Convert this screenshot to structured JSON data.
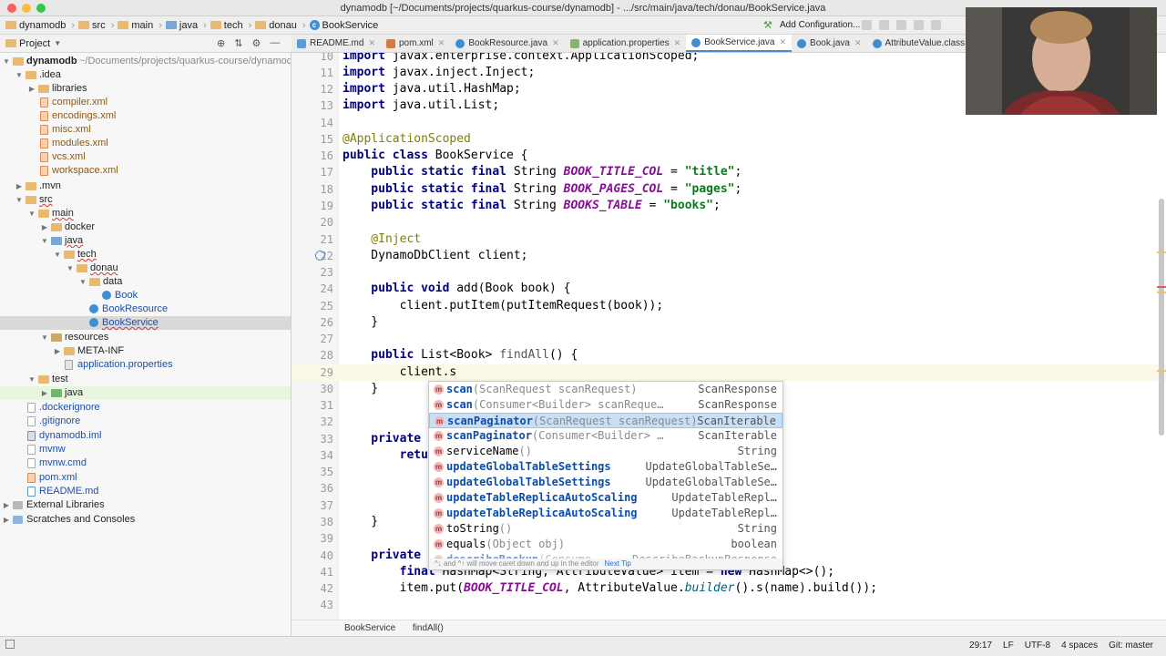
{
  "window": {
    "title": "dynamodb [~/Documents/projects/quarkus-course/dynamodb] - .../src/main/java/tech/donau/BookService.java"
  },
  "navbar": {
    "crumbs": [
      "dynamodb",
      "src",
      "main",
      "java",
      "tech",
      "donau",
      "BookService"
    ],
    "add_configuration": "Add Configuration..."
  },
  "project_panel": {
    "title": "Project",
    "tree": [
      {
        "label": "dynamodb",
        "extra": "~/Documents/projects/quarkus-course/dynamodb",
        "icon": "folder-icon"
      },
      {
        "label": ".idea",
        "icon": "folder-icon"
      },
      {
        "label": "libraries",
        "icon": "folder-icon"
      },
      {
        "label": "compiler.xml",
        "icon": "xml-file-icon"
      },
      {
        "label": "encodings.xml",
        "icon": "xml-file-icon"
      },
      {
        "label": "misc.xml",
        "icon": "xml-file-icon"
      },
      {
        "label": "modules.xml",
        "icon": "xml-file-icon"
      },
      {
        "label": "vcs.xml",
        "icon": "xml-file-icon"
      },
      {
        "label": "workspace.xml",
        "icon": "xml-file-icon"
      },
      {
        "label": ".mvn",
        "icon": "folder-icon"
      },
      {
        "label": "src",
        "icon": "folder-icon"
      },
      {
        "label": "main",
        "icon": "folder-icon"
      },
      {
        "label": "docker",
        "icon": "folder-icon"
      },
      {
        "label": "java",
        "icon": "source-folder-icon"
      },
      {
        "label": "tech",
        "icon": "package-icon"
      },
      {
        "label": "donau",
        "icon": "package-icon"
      },
      {
        "label": "data",
        "icon": "package-icon"
      },
      {
        "label": "Book",
        "icon": "class-icon"
      },
      {
        "label": "BookResource",
        "icon": "class-icon"
      },
      {
        "label": "BookService",
        "icon": "class-icon"
      },
      {
        "label": "resources",
        "icon": "resources-folder-icon"
      },
      {
        "label": "META-INF",
        "icon": "folder-icon"
      },
      {
        "label": "application.properties",
        "icon": "properties-file-icon"
      },
      {
        "label": "test",
        "icon": "folder-icon"
      },
      {
        "label": "java",
        "icon": "test-folder-icon"
      },
      {
        "label": ".dockerignore",
        "icon": "file-icon"
      },
      {
        "label": ".gitignore",
        "icon": "file-icon"
      },
      {
        "label": "dynamodb.iml",
        "icon": "iml-file-icon"
      },
      {
        "label": "mvnw",
        "icon": "file-icon"
      },
      {
        "label": "mvnw.cmd",
        "icon": "file-icon"
      },
      {
        "label": "pom.xml",
        "icon": "maven-file-icon"
      },
      {
        "label": "README.md",
        "icon": "markdown-file-icon"
      },
      {
        "label": "External Libraries",
        "icon": "library-icon"
      },
      {
        "label": "Scratches and Consoles",
        "icon": "scratches-icon"
      }
    ]
  },
  "tabs": [
    {
      "label": "README.md",
      "color": "#5b9bd5"
    },
    {
      "label": "pom.xml",
      "color": "#d97b3f"
    },
    {
      "label": "BookResource.java",
      "color": "#3d8fd1"
    },
    {
      "label": "application.properties",
      "color": "#8ab36f"
    },
    {
      "label": "BookService.java",
      "color": "#3d8fd1"
    },
    {
      "label": "Book.java",
      "color": "#3d8fd1"
    },
    {
      "label": "AttributeValue.class",
      "color": "#3d8fd1"
    }
  ],
  "editor": {
    "line_numbers": [
      "10",
      "11",
      "12",
      "13",
      "14",
      "15",
      "16",
      "17",
      "18",
      "19",
      "20",
      "21",
      "22",
      "23",
      "24",
      "25",
      "26",
      "27",
      "28",
      "29",
      "30",
      "31",
      "32",
      "33",
      "34",
      "35",
      "36",
      "37",
      "38",
      "39",
      "40",
      "41",
      "42",
      "43"
    ],
    "lines": {
      "l10a": "import ",
      "l10b": "javax.enterprise.context.ApplicationScoped;",
      "l11a": "import ",
      "l11b": "javax.inject.Inject;",
      "l12a": "import ",
      "l12b": "java.util.HashMap;",
      "l13a": "import ",
      "l13b": "java.util.List;",
      "l15": "@ApplicationScoped",
      "l16a": "public class ",
      "l16b": "BookService {",
      "l17a": "    public static final ",
      "l17b": "String ",
      "l17c": "BOOK_TITLE_COL",
      "l17d": " = ",
      "l17e": "\"title\"",
      "l17f": ";",
      "l18a": "    public static final ",
      "l18b": "String ",
      "l18c": "BOOK_PAGES_COL",
      "l18d": " = ",
      "l18e": "\"pages\"",
      "l18f": ";",
      "l19a": "    public static final ",
      "l19b": "String ",
      "l19c": "BOOKS_TABLE",
      "l19d": " = ",
      "l19e": "\"books\"",
      "l19f": ";",
      "l21": "    @Inject",
      "l22": "    DynamoDbClient client;",
      "l24a": "    public void ",
      "l24b": "add(Book book) {",
      "l25": "        client.putItem(putItemRequest(book));",
      "l26": "    }",
      "l28a": "    public ",
      "l28b": "List<Book> ",
      "l28c": "findAll",
      "l28d": "() {",
      "l29": "        client.s",
      "l30": "    }",
      "l33a": "    private ",
      "l33b": "S",
      "l34a": "        retur",
      "l38": "    }",
      "l40a": "    private ",
      "l40b": "(",
      "l41a": "        final ",
      "l41b": "HashMap<String, AttributeValue> item = ",
      "l41c": "new ",
      "l41d": "HashMap<>();",
      "l42a": "        item.put(",
      "l42b": "BOOK_TITLE_COL",
      "l42c": ", AttributeValue.",
      "l42d": "builder",
      "l42e": "().s(name).build());",
      "l43": ""
    }
  },
  "completion": {
    "items": [
      {
        "bold": "scan",
        "rest": "",
        "params": "(ScanRequest scanRequest)",
        "type": "ScanResponse"
      },
      {
        "bold": "scan",
        "rest": "",
        "params": "(Consumer<Builder> scanReque…",
        "type": "ScanResponse"
      },
      {
        "bold": "scanPaginator",
        "rest": "",
        "params": "(ScanRequest scanRequest)",
        "type": "ScanIterable"
      },
      {
        "bold": "scanPaginator",
        "rest": "",
        "params": "(Consumer<Builder> …",
        "type": "ScanIterable"
      },
      {
        "bold": "",
        "rest": "serviceName",
        "params": "()",
        "type": "String"
      },
      {
        "bold": "updateGlobalTableSettings",
        "rest": "",
        "params": "",
        "type": "UpdateGlobalTableSe…"
      },
      {
        "bold": "updateGlobalTableSettings",
        "rest": "",
        "params": "",
        "type": "UpdateGlobalTableSe…"
      },
      {
        "bold": "updateTableReplicaAutoScaling",
        "rest": "",
        "params": "",
        "type": "UpdateTableRepl…"
      },
      {
        "bold": "updateTableReplicaAutoScaling",
        "rest": "",
        "params": "",
        "type": "UpdateTableRepl…"
      },
      {
        "bold": "",
        "rest": "toString",
        "params": "()",
        "type": "String"
      },
      {
        "bold": "",
        "rest": "equals",
        "params": "(Object obj)",
        "type": "boolean"
      },
      {
        "bold": "describeBackup",
        "rest": "",
        "params": "(Consume…",
        "type": "DescribeBackupResponse"
      }
    ],
    "footer": "^↓ and ^↑ will move caret down and up in the editor",
    "next_tip": "Next Tip"
  },
  "editor_breadcrumb": [
    "BookService",
    "findAll()"
  ],
  "status": {
    "position": "29:17",
    "line_sep": "LF",
    "encoding": "UTF-8",
    "indent": "4 spaces",
    "git": "Git: master"
  },
  "colors": {
    "accent": "#4a88c7",
    "selection": "#c9dff5"
  }
}
